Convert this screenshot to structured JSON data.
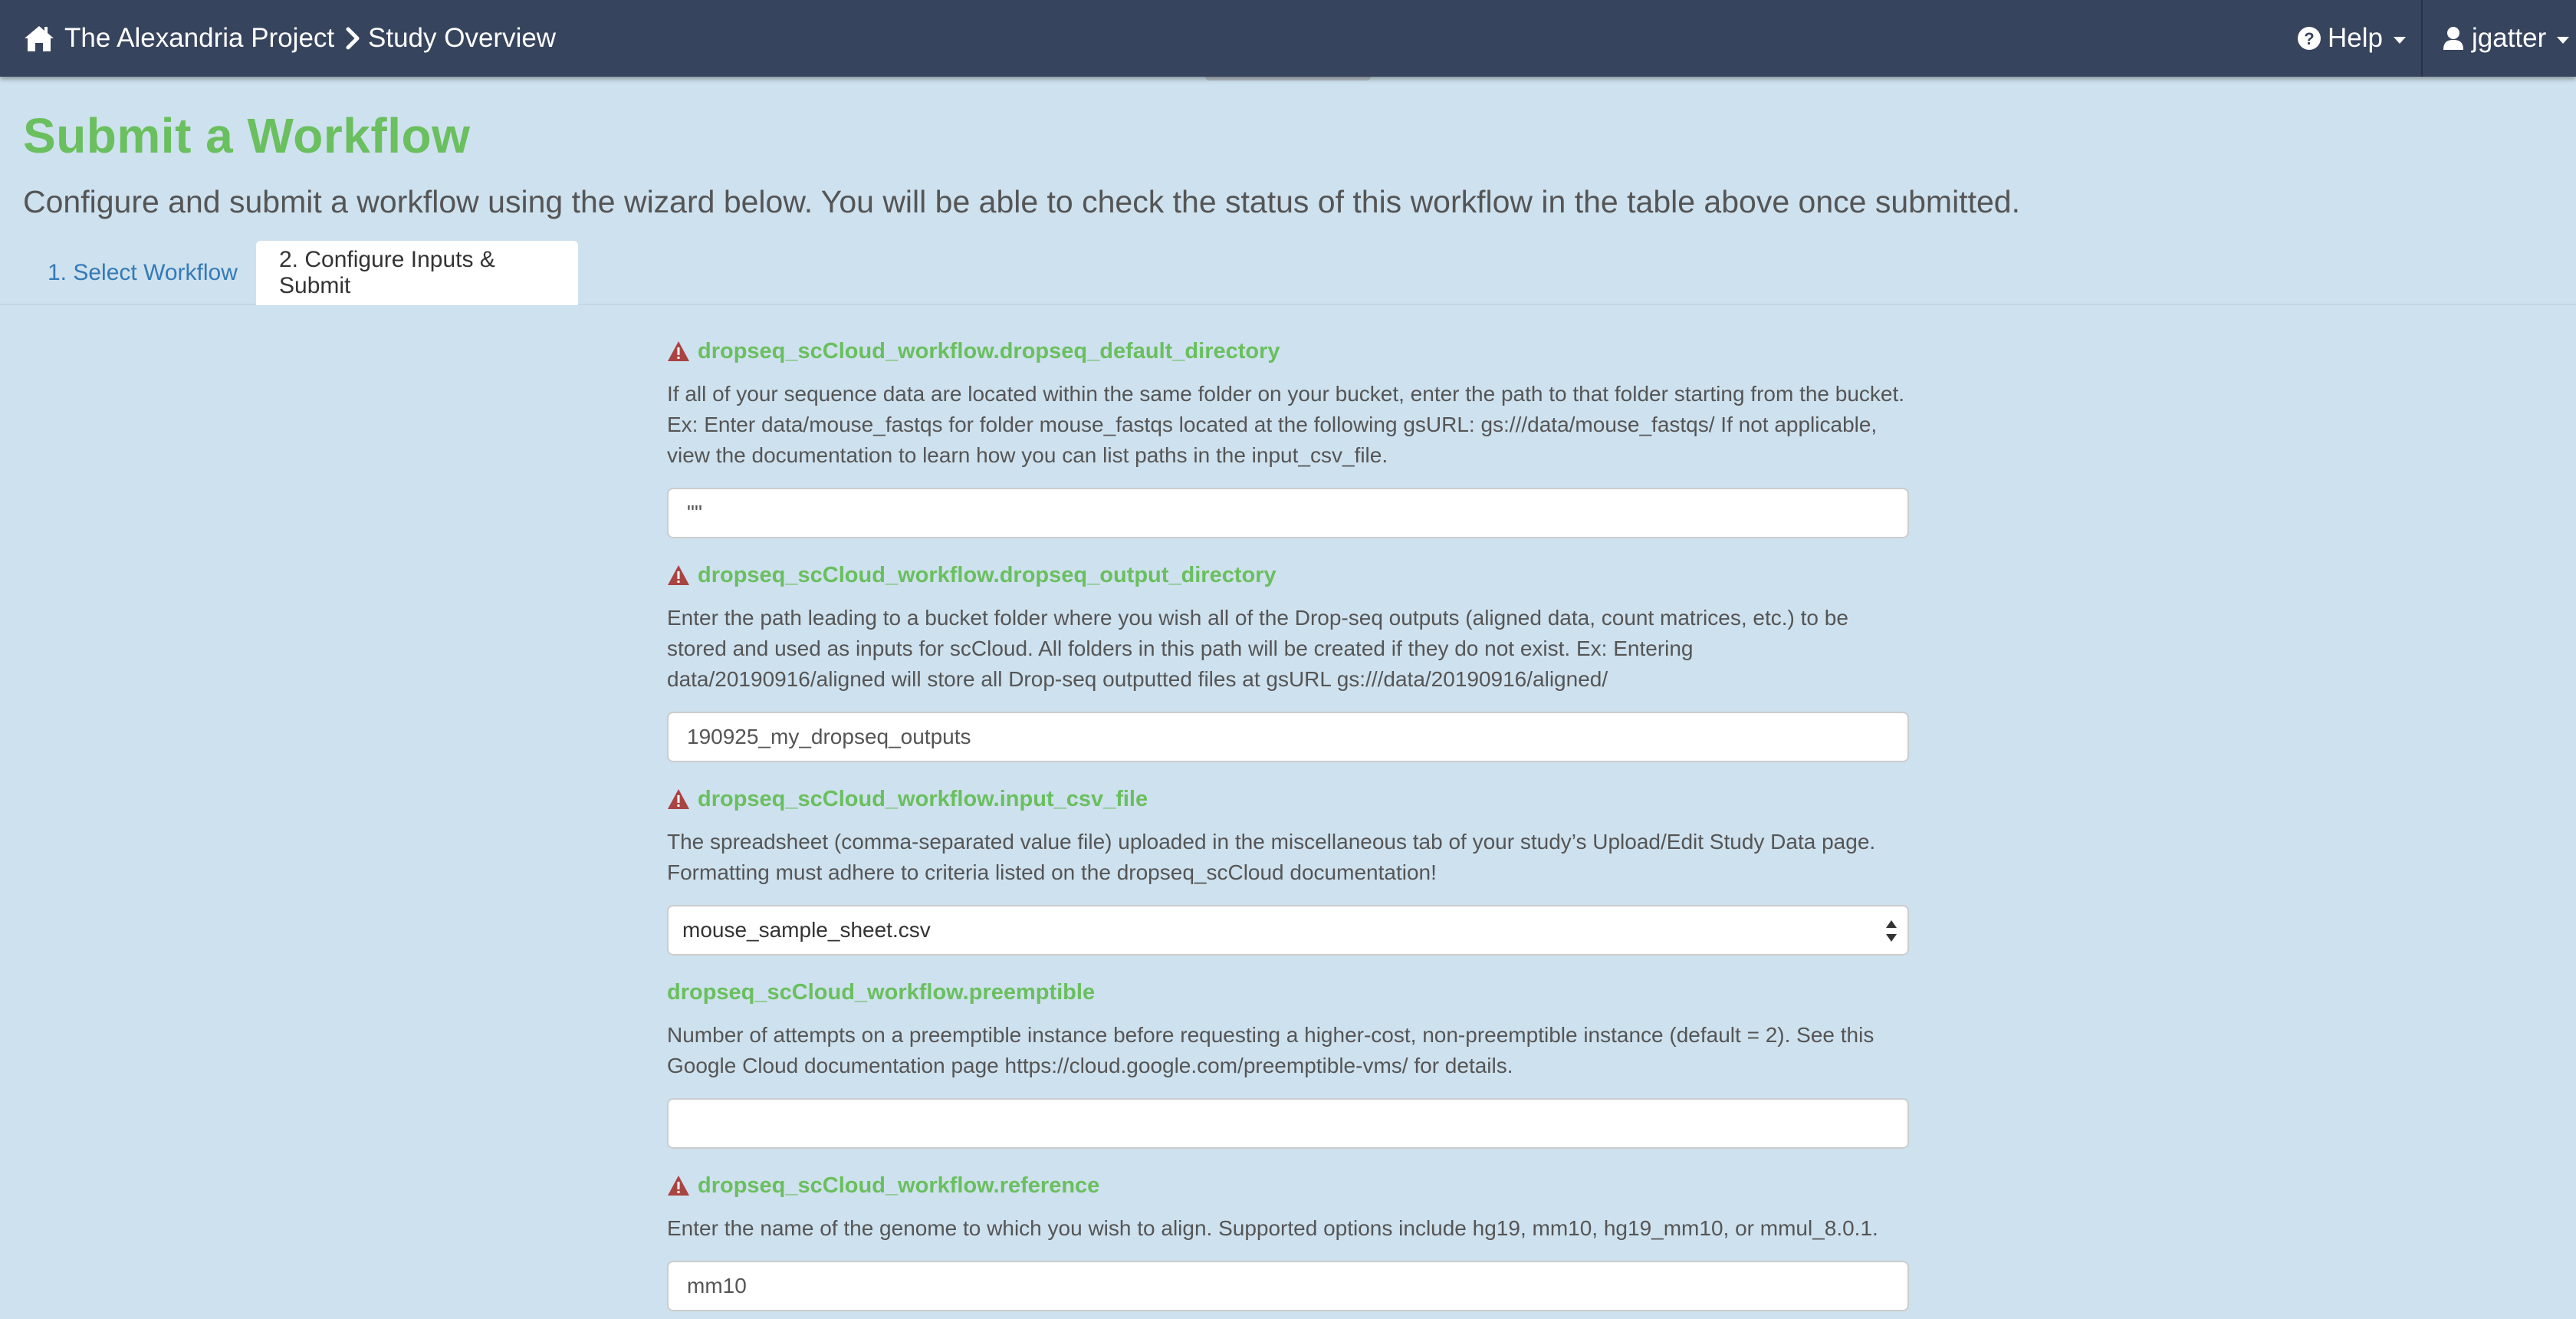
{
  "navbar": {
    "brand_icon": "home-icon",
    "brand_label": "The Alexandria Project",
    "breadcrumb_icon": "chevron-right-icon",
    "breadcrumb_label": "Study Overview",
    "help_icon": "question-circle-icon",
    "help_label": "Help",
    "user_icon": "user-icon",
    "user_label": "jgatter"
  },
  "header": {
    "title": "Submit a Workflow",
    "subtitle": "Configure and submit a workflow using the wizard below. You will be able to check the status of this workflow in the table above once submitted."
  },
  "tabs": [
    {
      "label": "1. Select Workflow",
      "active": false
    },
    {
      "label": "2. Configure Inputs & Submit",
      "active": true
    }
  ],
  "colors": {
    "navbar": "#37445e",
    "background": "#cee1ee",
    "accent_green": "#6abf5e",
    "link_blue": "#337ab7",
    "warning_red": "#a94442"
  },
  "fields": [
    {
      "label": "dropseq_scCloud_workflow.dropseq_default_directory",
      "required": true,
      "icon": "warning-icon",
      "help": "If all of your sequence data are located within the same folder on your bucket, enter the path to that folder starting from the bucket. Ex: Enter data/mouse_fastqs for folder mouse_fastqs located at the following gsURL: gs:///data/mouse_fastqs/ If not applicable, view the documentation to learn how you can list paths in the input_csv_file.",
      "value": "\"\"",
      "control": "text"
    },
    {
      "label": "dropseq_scCloud_workflow.dropseq_output_directory",
      "required": true,
      "icon": "warning-icon",
      "help": "Enter the path leading to a bucket folder where you wish all of the Drop-seq outputs (aligned data, count matrices, etc.) to be stored and used as inputs for scCloud. All folders in this path will be created if they do not exist. Ex: Entering data/20190916/aligned will store all Drop-seq outputted files at gsURL gs:///data/20190916/aligned/",
      "value": "190925_my_dropseq_outputs",
      "control": "text"
    },
    {
      "label": "dropseq_scCloud_workflow.input_csv_file",
      "required": true,
      "icon": "warning-icon",
      "help": "The spreadsheet (comma-separated value file) uploaded in the miscellaneous tab of your study’s Upload/Edit Study Data page. Formatting must adhere to criteria listed on the dropseq_scCloud documentation!",
      "value": "mouse_sample_sheet.csv",
      "control": "select"
    },
    {
      "label": "dropseq_scCloud_workflow.preemptible",
      "required": false,
      "help": "Number of attempts on a preemptible instance before requesting a higher-cost, non-preemptible instance (default = 2). See this Google Cloud documentation page https://cloud.google.com/preemptible-vms/ for details.",
      "value": "",
      "control": "text"
    },
    {
      "label": "dropseq_scCloud_workflow.reference",
      "required": true,
      "icon": "warning-icon",
      "help": "Enter the name of the genome to which you wish to align. Supported options include hg19, mm10, hg19_mm10, or mmul_8.0.1.",
      "value": "mm10",
      "control": "text"
    }
  ]
}
